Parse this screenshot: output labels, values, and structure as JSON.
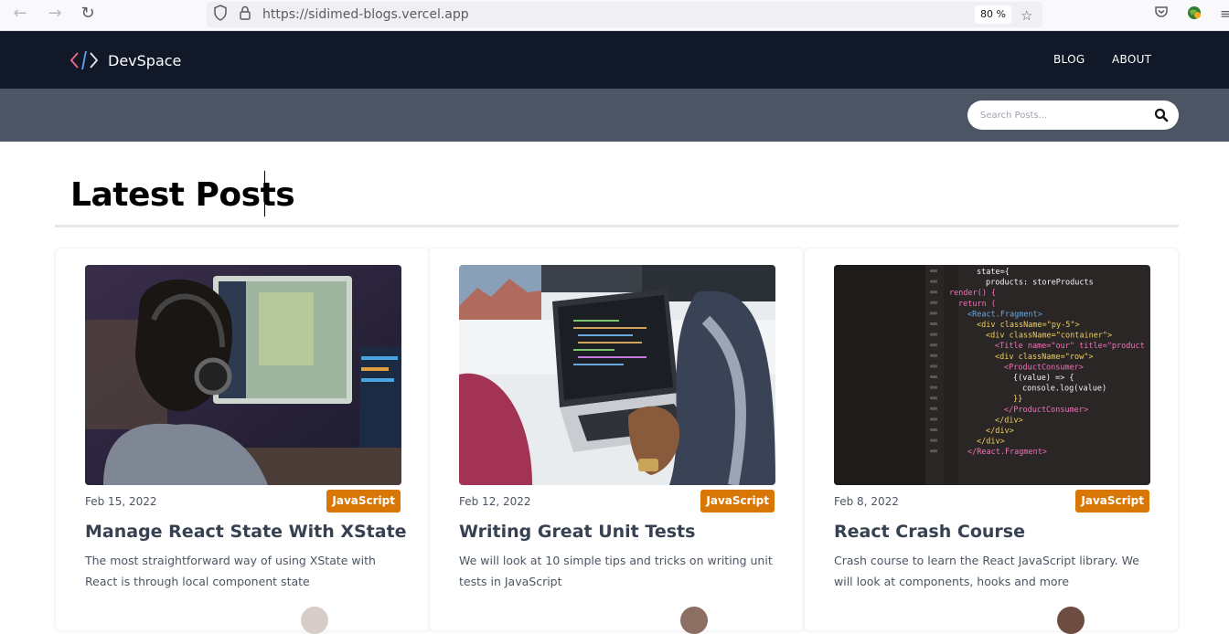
{
  "browser": {
    "url": "https://sidimed-blogs.vercel.app",
    "zoom": "80 %"
  },
  "site": {
    "brand": "DevSpace",
    "nav": [
      {
        "label": "BLOG"
      },
      {
        "label": "ABOUT"
      }
    ],
    "search_placeholder": "Search Posts..."
  },
  "main": {
    "title": "Latest Posts",
    "posts": [
      {
        "date": "Feb 15, 2022",
        "category": "JavaScript",
        "title": "Manage React State With XState",
        "excerpt": "The most straightforward way of using XState with React is through local component state"
      },
      {
        "date": "Feb 12, 2022",
        "category": "JavaScript",
        "title": "Writing Great Unit Tests",
        "excerpt": "We will look at 10 simple tips and tricks on writing unit tests in JavaScript"
      },
      {
        "date": "Feb 8, 2022",
        "category": "JavaScript",
        "title": "React Crash Course",
        "excerpt": "Crash course to learn the React JavaScript library. We will look at components, hooks and more"
      }
    ]
  },
  "colors": {
    "header_bg": "#111827",
    "search_strip_bg": "#4b5563",
    "badge_bg": "#d97706"
  },
  "code_lines": [
    "state={",
    "products: storeProducts",
    "render() {",
    "return (",
    "<React.Fragment>",
    "<div className=\"py-5\">",
    "<div className=\"container\">",
    "<Title name=\"our\" title=\"product",
    "<div className=\"row\">",
    "<ProductConsumer>",
    "{(value) => {",
    "console.log(value)",
    "}}",
    "</ProductConsumer>",
    "</div>",
    "</div>",
    "</div>",
    "</React.Fragment>"
  ]
}
